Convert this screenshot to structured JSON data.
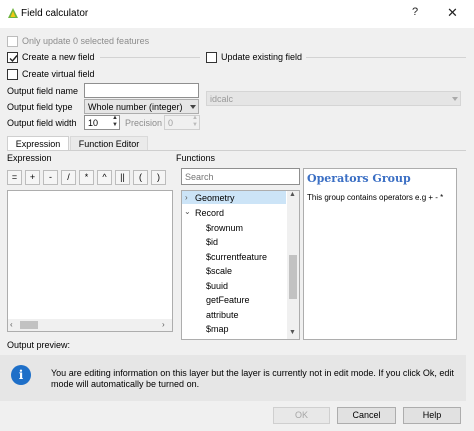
{
  "window": {
    "title": "Field calculator",
    "help": "?",
    "close": "✕"
  },
  "options": {
    "only_update": "Only update 0 selected features",
    "create_new_field": "Create a new field",
    "update_existing_field": "Update existing field",
    "create_virtual_field": "Create virtual field",
    "create_new_field_checked": true,
    "create_virtual_field_checked": false
  },
  "fields": {
    "output_name_label": "Output field name",
    "output_name_value": "",
    "output_type_label": "Output field type",
    "output_type_value": "Whole number (integer)",
    "output_width_label": "Output field width",
    "output_width_value": "10",
    "precision_label": "Precision",
    "precision_value": "0",
    "existing_field_value": "idcalc"
  },
  "tabs": [
    {
      "label": "Expression",
      "active": true
    },
    {
      "label": "Function Editor",
      "active": false
    }
  ],
  "expression": {
    "label": "Expression",
    "operators": [
      "=",
      "+",
      "-",
      "/",
      "*",
      "^",
      "||",
      "(",
      ")"
    ]
  },
  "functions": {
    "label": "Functions",
    "search_placeholder": "Search",
    "tree": [
      {
        "label": "Geometry",
        "type": "group",
        "expanded": false
      },
      {
        "label": "Record",
        "type": "group",
        "expanded": true
      },
      {
        "label": "$rownum",
        "type": "item"
      },
      {
        "label": "$id",
        "type": "item"
      },
      {
        "label": "$currentfeature",
        "type": "item"
      },
      {
        "label": "$scale",
        "type": "item"
      },
      {
        "label": "$uuid",
        "type": "item"
      },
      {
        "label": "getFeature",
        "type": "item"
      },
      {
        "label": "attribute",
        "type": "item"
      },
      {
        "label": "$map",
        "type": "item"
      }
    ]
  },
  "help_panel": {
    "title": "Operators Group",
    "body": "This group contains operators e.g + - *"
  },
  "preview": {
    "label": "Output preview:"
  },
  "info": {
    "message": "You are editing information on this layer but the layer is currently not in edit mode. If you click Ok, edit mode will automatically be turned on."
  },
  "buttons": {
    "ok": "OK",
    "cancel": "Cancel",
    "help": "Help"
  },
  "colors": {
    "accent_title": "#3b6fc4",
    "info_icon": "#1e6fc8",
    "check_mark": "#222222"
  }
}
